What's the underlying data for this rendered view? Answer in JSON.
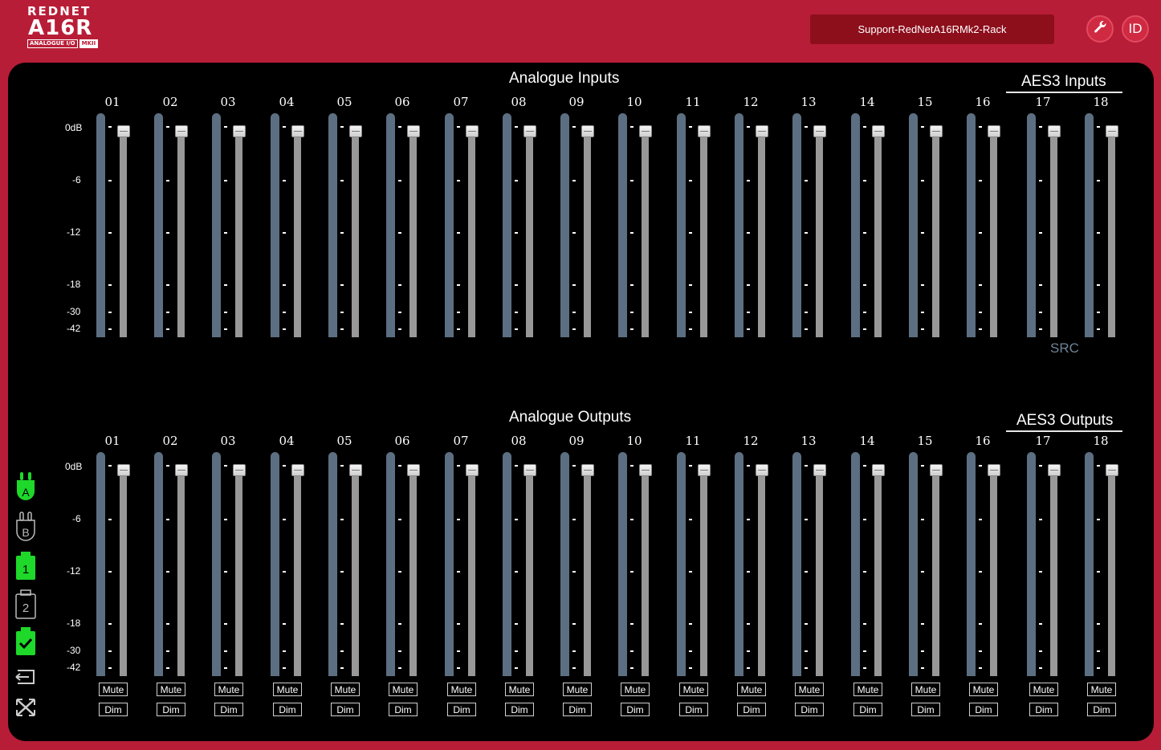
{
  "header": {
    "brand": "REDNET",
    "model": "A16R",
    "subtitle": "ANALOGUE I/O",
    "mark": "MKII",
    "device_name": "Support-RedNetA16RMk2-Rack",
    "tools_icon": "wrench-icon",
    "id_label": "ID"
  },
  "inputs": {
    "title": "Analogue Inputs",
    "aes_title": "AES3 Inputs",
    "src_label": "SRC",
    "channels": [
      "01",
      "02",
      "03",
      "04",
      "05",
      "06",
      "07",
      "08",
      "09",
      "10",
      "11",
      "12",
      "13",
      "14",
      "15",
      "16",
      "17",
      "18"
    ]
  },
  "outputs": {
    "title": "Analogue Outputs",
    "aes_title": "AES3 Outputs",
    "channels": [
      "01",
      "02",
      "03",
      "04",
      "05",
      "06",
      "07",
      "08",
      "09",
      "10",
      "11",
      "12",
      "13",
      "14",
      "15",
      "16",
      "17",
      "18"
    ],
    "mute_label": "Mute",
    "dim_label": "Dim"
  },
  "scale_labels": [
    "0dB",
    "-6",
    "-12",
    "-18",
    "-30",
    "-42"
  ],
  "sidebar": {
    "items": [
      {
        "icon": "network-a-icon",
        "label": "A",
        "active": true
      },
      {
        "icon": "network-b-icon",
        "label": "B",
        "active": false
      },
      {
        "icon": "psu-1-icon",
        "label": "1",
        "active": true
      },
      {
        "icon": "psu-2-icon",
        "label": "2",
        "active": false
      },
      {
        "icon": "clock-lock-icon",
        "label": "",
        "active": true
      },
      {
        "icon": "logout-icon",
        "label": "",
        "active": false
      },
      {
        "icon": "crossed-arrows-icon",
        "label": "",
        "active": false
      }
    ]
  },
  "colors": {
    "brand": "#b81d37",
    "status_active": "#1ed82a",
    "meter": "#5c6f82"
  }
}
